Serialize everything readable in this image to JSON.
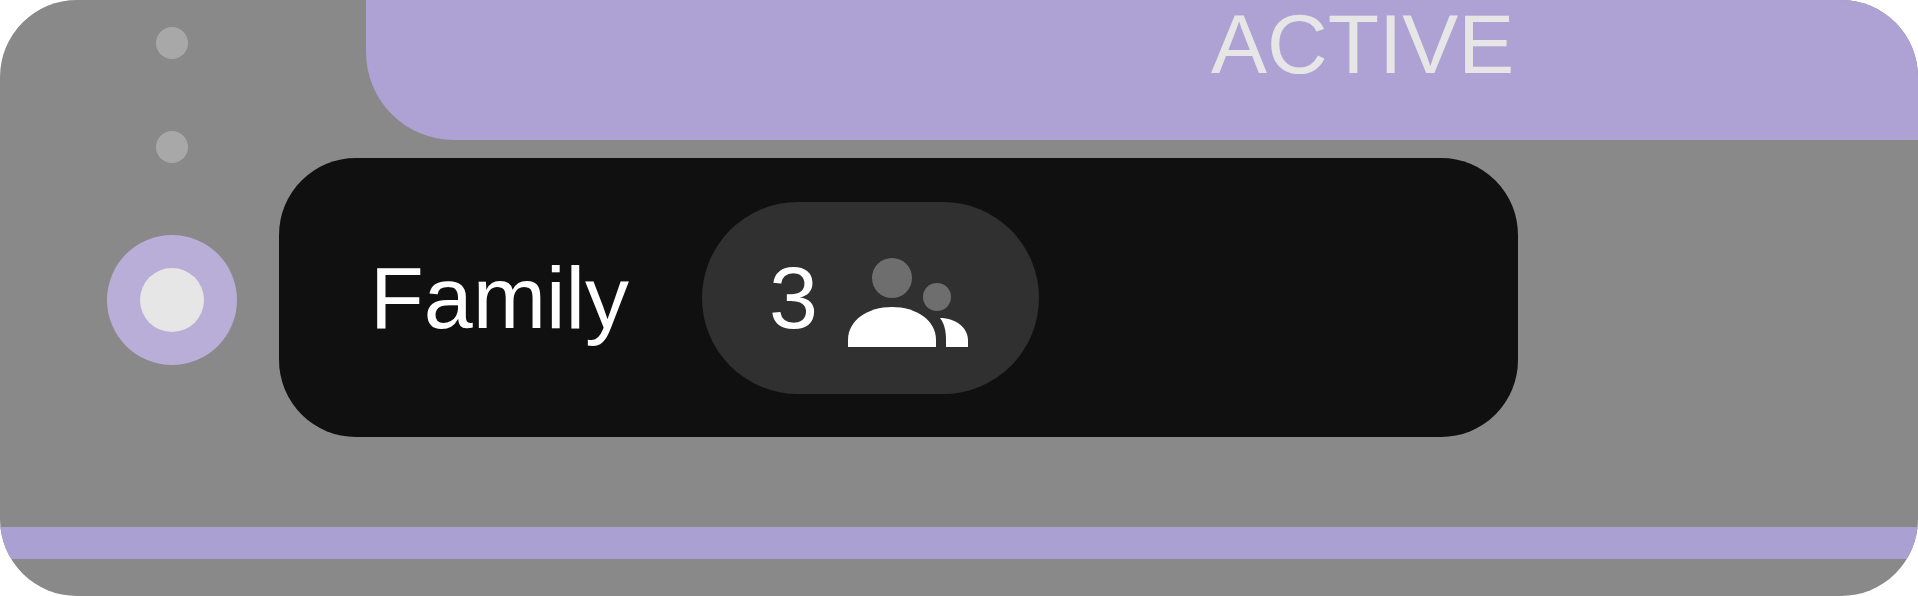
{
  "status": {
    "label": "ACTIVE"
  },
  "steps": [
    {
      "selected": false
    },
    {
      "selected": false
    },
    {
      "selected": true
    }
  ],
  "group": {
    "name": "Family",
    "member_count": "3"
  }
}
